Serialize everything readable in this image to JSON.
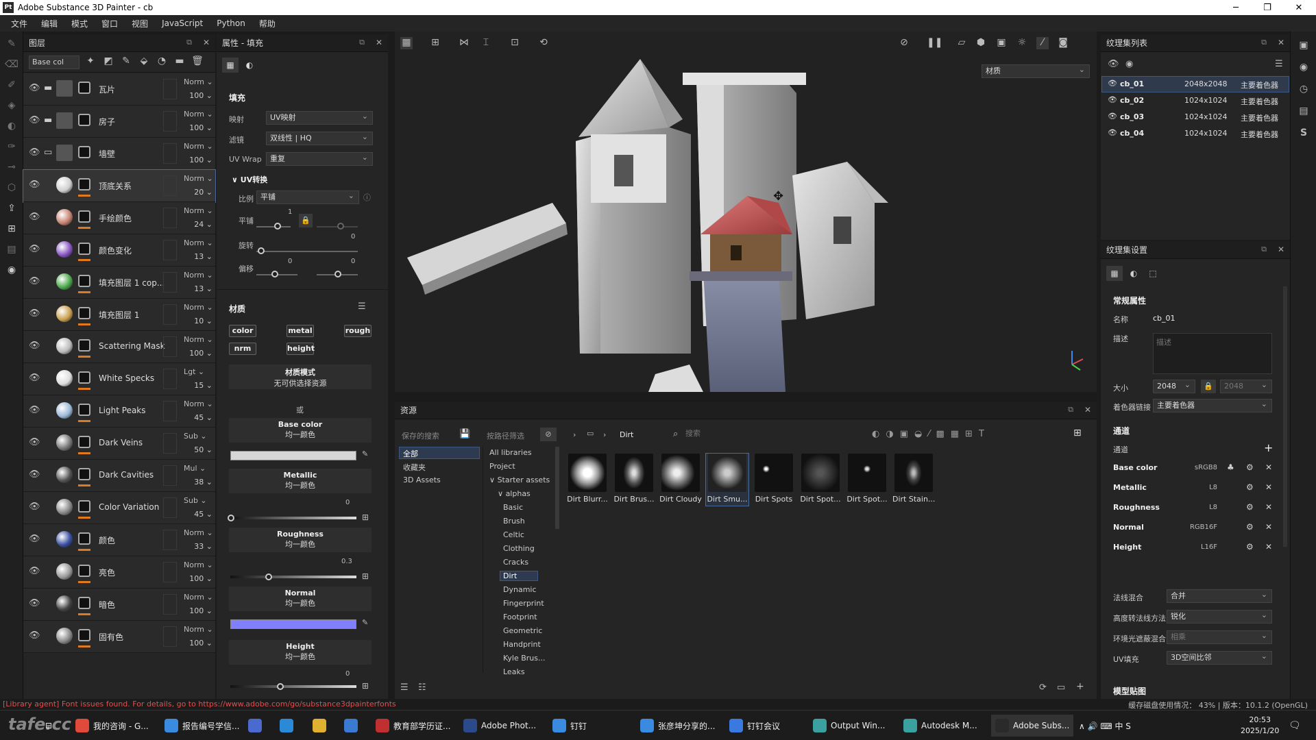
{
  "window": {
    "app_icon": "Pt",
    "title": "Adobe Substance 3D Painter - cb",
    "minimize": "─",
    "maximize": "❐",
    "close": "✕"
  },
  "menu": [
    "文件",
    "编辑",
    "模式",
    "窗口",
    "视图",
    "JavaScript",
    "Python",
    "帮助"
  ],
  "layers_panel": {
    "title": "图层",
    "channel_select": "Base col",
    "layers": [
      {
        "name": "瓦片",
        "blend": "Norm",
        "opacity": "100",
        "type": "folder"
      },
      {
        "name": "房子",
        "blend": "Norm",
        "opacity": "100",
        "type": "folder"
      },
      {
        "name": "墙壁",
        "blend": "Norm",
        "opacity": "100",
        "type": "folder-open"
      },
      {
        "name": "顶底关系",
        "blend": "Norm",
        "opacity": "20",
        "type": "fill",
        "color": "#cfcfcf",
        "selected": true
      },
      {
        "name": "手绘颜色",
        "blend": "Norm",
        "opacity": "24",
        "type": "fill",
        "color": "#c58270"
      },
      {
        "name": "颜色变化",
        "blend": "Norm",
        "opacity": "13",
        "type": "fill",
        "color": "#8855c0"
      },
      {
        "name": "填充图层 1 cop...",
        "blend": "Norm",
        "opacity": "13",
        "type": "fill",
        "color": "#4aa84a"
      },
      {
        "name": "填充图层 1",
        "blend": "Norm",
        "opacity": "10",
        "type": "fill",
        "color": "#c8a050"
      },
      {
        "name": "Scattering Mask",
        "blend": "Norm",
        "opacity": "100",
        "type": "fill",
        "color": "#bbbbbb"
      },
      {
        "name": "White Specks",
        "blend": "Lgt",
        "opacity": "15",
        "type": "fill",
        "color": "#dddddd"
      },
      {
        "name": "Light Peaks",
        "blend": "Norm",
        "opacity": "45",
        "type": "fill",
        "color": "#9ab8d8"
      },
      {
        "name": "Dark Veins",
        "blend": "Sub",
        "opacity": "50",
        "type": "fill",
        "color": "#777777"
      },
      {
        "name": "Dark Cavities",
        "blend": "Mul",
        "opacity": "38",
        "type": "fill",
        "color": "#555555"
      },
      {
        "name": "Color Variation",
        "blend": "Sub",
        "opacity": "45",
        "type": "fill",
        "color": "#888888"
      },
      {
        "name": "颜色",
        "blend": "Norm",
        "opacity": "33",
        "type": "fill",
        "color": "#3a4fa0"
      },
      {
        "name": "亮色",
        "blend": "Norm",
        "opacity": "100",
        "type": "fill",
        "color": "#999999"
      },
      {
        "name": "暗色",
        "blend": "Norm",
        "opacity": "100",
        "type": "fill",
        "color": "#444444"
      },
      {
        "name": "固有色",
        "blend": "Norm",
        "opacity": "100",
        "type": "fill",
        "color": "#888888"
      }
    ]
  },
  "properties": {
    "title": "属性 - 填充",
    "fill_header": "填充",
    "projection_label": "映射",
    "projection": "UV映射",
    "filter_label": "滤镜",
    "filter": "双线性 | HQ",
    "uvwrap_label": "UV Wrap",
    "uvwrap": "重复",
    "uv_transform": "UV转换",
    "scale_label": "比例",
    "scale": "平铺",
    "tile_label": "平铺",
    "tile_val": "1",
    "rotate_label": "旋转",
    "rotate_val": "0",
    "offset_label": "偏移",
    "offset_val1": "0",
    "offset_val2": "0",
    "material_header": "材质",
    "chips": [
      "color",
      "metal",
      "rough",
      "nrm",
      "height"
    ],
    "material_mode": "材质模式",
    "material_mode_sub": "无可供选择资源",
    "or": "或",
    "base_color": "Base color",
    "uniform": "均一颜色",
    "base_color_value": "#d6d6d6",
    "metallic": "Metallic",
    "metallic_val": "0",
    "roughness": "Roughness",
    "roughness_val": "0.3",
    "normal": "Normal",
    "normal_color": "#8080ff",
    "height": "Height",
    "height_val": "0"
  },
  "viewport": {
    "material_dropdown": "材质"
  },
  "texture_set_list": {
    "title": "纹理集列表",
    "rows": [
      {
        "name": "cb_01",
        "size": "2048x2048",
        "shader": "主要着色器",
        "selected": true
      },
      {
        "name": "cb_02",
        "size": "1024x1024",
        "shader": "主要着色器"
      },
      {
        "name": "cb_03",
        "size": "1024x1024",
        "shader": "主要着色器"
      },
      {
        "name": "cb_04",
        "size": "1024x1024",
        "shader": "主要着色器"
      }
    ]
  },
  "texture_set_settings": {
    "title": "纹理集设置",
    "general": "常规属性",
    "name_label": "名称",
    "name": "cb_01",
    "desc_label": "描述",
    "desc_placeholder": "描述",
    "size_label": "大小",
    "size": "2048",
    "size2": "2048",
    "shader_label": "着色器链接",
    "shader": "主要着色器",
    "channels_header": "通道",
    "channels_label": "通道",
    "channels": [
      {
        "name": "Base color",
        "fmt": "sRGB8"
      },
      {
        "name": "Metallic",
        "fmt": "L8"
      },
      {
        "name": "Roughness",
        "fmt": "L8"
      },
      {
        "name": "Normal",
        "fmt": "RGB16F"
      },
      {
        "name": "Height",
        "fmt": "L16F"
      }
    ],
    "normal_mix_label": "法线混合",
    "normal_mix": "合并",
    "height_normal_label": "高度转法线方法",
    "height_normal": "锐化",
    "ao_mix_label": "环境光遮蔽混合",
    "ao_mix": "相乘",
    "uv_pad_label": "UV填充",
    "uv_pad": "3D空间比邻",
    "mesh_maps": "模型贴图"
  },
  "assets": {
    "title": "资源",
    "saved_search": "保存的搜索",
    "filter_by": "按路径筛选",
    "breadcrumb": "Dirt",
    "search_placeholder": "搜索",
    "left_list": [
      "全部",
      "收藏夹",
      "3D Assets"
    ],
    "tree": [
      {
        "t": "All libraries",
        "x": 0
      },
      {
        "t": "Project",
        "x": 0
      },
      {
        "t": "Starter assets",
        "x": 0,
        "arrow": "∨"
      },
      {
        "t": "alphas",
        "x": 12,
        "arrow": "∨"
      },
      {
        "t": "Basic",
        "x": 20
      },
      {
        "t": "Brush",
        "x": 20
      },
      {
        "t": "Celtic",
        "x": 20
      },
      {
        "t": "Clothing",
        "x": 20
      },
      {
        "t": "Cracks",
        "x": 20
      },
      {
        "t": "Dirt",
        "x": 20,
        "selected": true
      },
      {
        "t": "Dynamic",
        "x": 20
      },
      {
        "t": "Fingerprint",
        "x": 20
      },
      {
        "t": "Footprint",
        "x": 20
      },
      {
        "t": "Geometric",
        "x": 20
      },
      {
        "t": "Handprint",
        "x": 20
      },
      {
        "t": "Kyle Brus...",
        "x": 20
      },
      {
        "t": "Leaks",
        "x": 20
      }
    ],
    "items": [
      "Dirt Blurr...",
      "Dirt Brus...",
      "Dirt Cloudy",
      "Dirt Smu...",
      "Dirt Spots",
      "Dirt Spot...",
      "Dirt Spot...",
      "Dirt Stain..."
    ]
  },
  "status": {
    "left": "[Library agent] Font issues found. For details, go to https://www.adobe.com/go/substance3dpainterfonts",
    "right": "缓存磁盘使用情况：  43% | 版本：10.1.2 (OpenGL)"
  },
  "taskbar": {
    "apps": [
      {
        "label": "我的咨询 - G...",
        "color": "#e04a3a"
      },
      {
        "label": "报告编号学信...",
        "color": "#3a8ae0"
      },
      {
        "label": "",
        "color": "#4a6ad0"
      },
      {
        "label": "",
        "color": "#2a8ad8"
      },
      {
        "label": "",
        "color": "#e0b030"
      },
      {
        "label": "",
        "color": "#3a7ad0"
      },
      {
        "label": "教育部学历证...",
        "color": "#c03030"
      },
      {
        "label": "Adobe Phot...",
        "color": "#2a4a8a"
      },
      {
        "label": "钉钉",
        "color": "#3a8ae0"
      },
      {
        "label": "张彦坤分享的...",
        "color": "#3a8ae0"
      },
      {
        "label": "钉钉会议",
        "color": "#3a7ae0"
      },
      {
        "label": "Output Win...",
        "color": "#3aa0a0"
      },
      {
        "label": "Autodesk M...",
        "color": "#3aa0a0"
      },
      {
        "label": "Adobe Subs...",
        "color": "#2a2a2a"
      }
    ],
    "tray": "∧  🔊  ⌨  中  S",
    "time": "20:53",
    "date": "2025/1/20"
  },
  "watermark": "tafe.cc"
}
